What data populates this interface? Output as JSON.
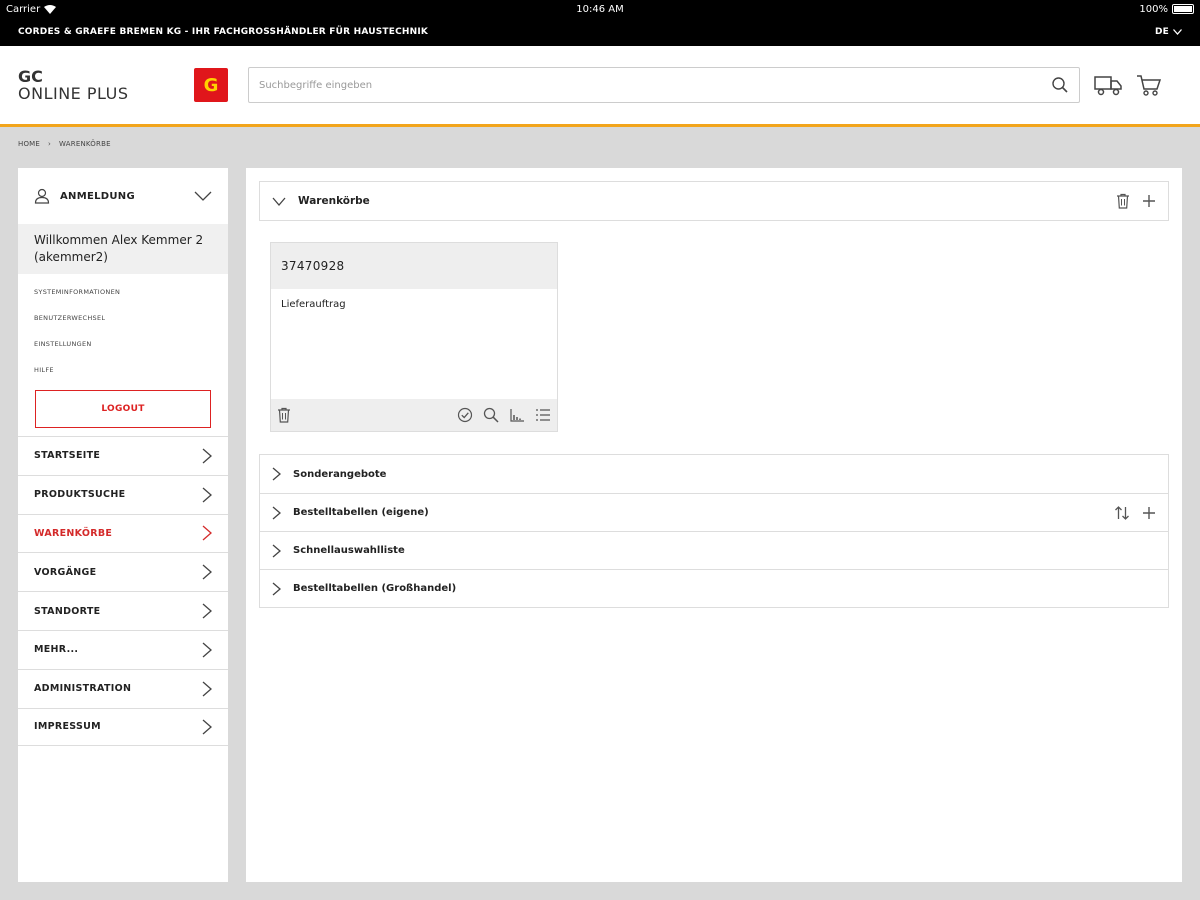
{
  "statusbar": {
    "carrier": "Carrier",
    "time": "10:46 AM",
    "battery": "100%"
  },
  "companybar": {
    "title": "CORDES & GRAEFE BREMEN KG - IHR FACHGROSSHÄNDLER FÜR HAUSTECHNIK",
    "language": "DE"
  },
  "header": {
    "brand_line1": "GC",
    "brand_line2": "ONLINE PLUS",
    "logo_text": "G",
    "search_placeholder": "Suchbegriffe eingeben"
  },
  "breadcrumb": [
    "HOME",
    "›",
    "WARENKÖRBE"
  ],
  "sidebar": {
    "login_label": "ANMELDUNG",
    "welcome": "Willkommen Alex Kemmer 2 (akemmer2)",
    "sub_links": [
      "SYSTEMINFORMATIONEN",
      "BENUTZERWECHSEL",
      "EINSTELLUNGEN",
      "HILFE"
    ],
    "logout_label": "LOGOUT",
    "nav": [
      "STARTSEITE",
      "PRODUKTSUCHE",
      "WARENKÖRBE",
      "VORGÄNGE",
      "STANDORTE",
      "MEHR...",
      "ADMINISTRATION",
      "IMPRESSUM"
    ]
  },
  "main": {
    "top_section": "Warenkörbe",
    "card": {
      "number": "37470928",
      "type": "Lieferauftrag"
    },
    "sections": [
      "Sonderangebote",
      "Bestelltabellen (eigene)",
      "Schnellauswahlliste",
      "Bestelltabellen (Großhandel)"
    ]
  },
  "colors": {
    "accent": "#f2a51c",
    "active": "#d42a2a",
    "logo": "#e0161b"
  }
}
